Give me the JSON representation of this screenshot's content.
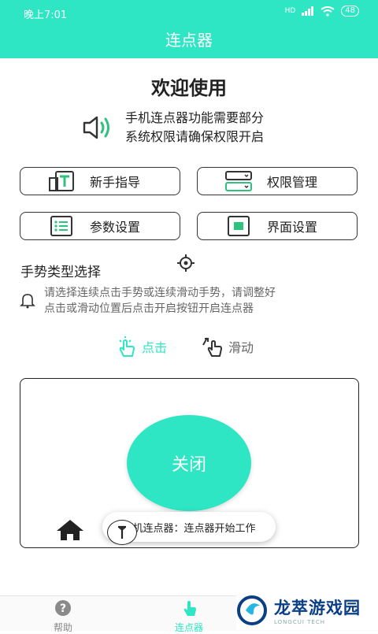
{
  "status_bar": {
    "time": "晚上7:01",
    "signal": "HD",
    "battery": "48"
  },
  "app_bar": {
    "title": "连点器"
  },
  "welcome": {
    "title": "欢迎使用"
  },
  "notice": {
    "line1": "手机连点器功能需要部分",
    "line2": "系统权限请确保权限开启",
    "icon": "speaker-icon"
  },
  "buttons": [
    {
      "label": "新手指导",
      "icon": "tutorial-icon"
    },
    {
      "label": "权限管理",
      "icon": "permission-icon"
    },
    {
      "label": "参数设置",
      "icon": "list-icon"
    },
    {
      "label": "界面设置",
      "icon": "screen-icon"
    }
  ],
  "gesture_section": {
    "title": "手势类型选择",
    "hint_line1": "请选择连续点击手势或连续滑动手势，请调整好",
    "hint_line2": "点击或滑动位置后点击开启按钮开启连点器",
    "options": [
      {
        "label": "点击",
        "selected": true,
        "icon": "tap-hand-icon"
      },
      {
        "label": "滑动",
        "selected": false,
        "icon": "swipe-hand-icon"
      }
    ]
  },
  "control": {
    "toggle_label": "关闭"
  },
  "toast": {
    "text": "手机连点器：连点器开始工作"
  },
  "tabs": [
    {
      "label": "帮助",
      "icon": "help-icon",
      "active": false
    },
    {
      "label": "连点器",
      "icon": "clicker-icon",
      "active": true
    }
  ],
  "watermark": {
    "title": "龙萃游戏园",
    "subtitle": "LONGCUI TECH"
  },
  "colors": {
    "accent": "#2ee6c4",
    "active_tab": "#2ee6c4",
    "inactive_tab": "#888888"
  }
}
